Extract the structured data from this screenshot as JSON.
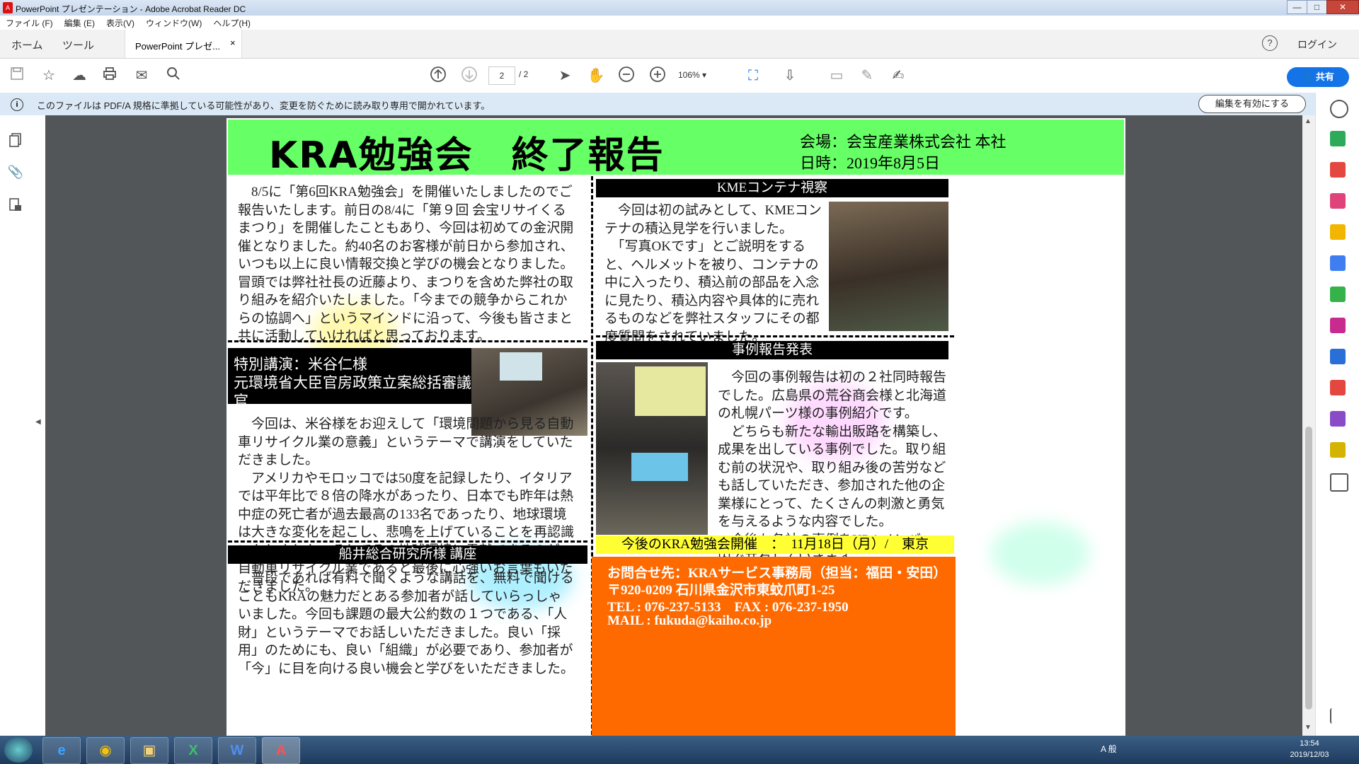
{
  "window": {
    "title": "PowerPoint プレゼンテーション - Adobe Acrobat Reader DC",
    "controls": [
      "—",
      "□",
      "✕"
    ]
  },
  "menu": [
    "ファイル (F)",
    "編集 (E)",
    "表示(V)",
    "ウィンドウ(W)",
    "ヘルプ(H)"
  ],
  "tabs": {
    "home": "ホーム",
    "tools": "ツール",
    "doc": "PowerPoint プレゼ...",
    "close": "×",
    "help": "?",
    "login": "ログイン"
  },
  "toolbar": {
    "page_current": "2",
    "page_total": "/ 2",
    "zoom": "106%",
    "share": "共有"
  },
  "infobar": {
    "icon": "i",
    "message": "このファイルは PDF/A 規格に準拠している可能性があり、変更を防ぐために読み取り専用で開かれています。",
    "button": "編集を有効にする"
  },
  "doc": {
    "header_title": "KRA勉強会　終了報告",
    "venue": "会場：会宝産業株式会社 本社",
    "date": "日時：2019年8月5日",
    "intro": "　8/5に「第6回KRA勉強会」を開催いたしましたのでご報告いたします。前日の8/4に「第９回 会宝リサイくるまつり」を開催したこともあり、今回は初めての金沢開催となりました。約40名のお客様が前日から参加され、いつも以上に良い情報交換と学びの機会となりました。冒頭では弊社社長の近藤より、まつりを含めた弊社の取り組みを紹介いたしました。「今までの競争からこれからの協調へ」というマインドに沿って、今後も皆さまと共に活動していければと思っております。",
    "special_title_1": "特別講演：米谷仁様",
    "special_title_2": "元環境省大臣官房政策立案総括審議官",
    "special_body": "　今回は、米谷様をお迎えして「環境問題から見る自動車リサイクル業の意義」というテーマで講演をしていただきました。\n　アメリカやモロッコでは50度を記録したり、イタリアでは平年比で８倍の降水があったり、日本でも昨年は熱中症の死亡者が過去最高の133名であったり、地球環境は大きな変化を起こし、悲鳴を上げていることを再認識いたしました。そしてその地球環境に貢献できるのが、自動車リサイクル業であると最後に心強いお言葉もいただきました。",
    "funai_title": "船井総合研究所様 講座",
    "funai_body": "　普段であれば有料で聞くような講話を、無料で聞けることもKRAの魅力だとある参加者が話していらっしゃいました。今回も課題の最大公約数の１つである、「人財」というテーマでお話しいただきました。良い「採用」のためにも、良い「組織」が必要であり、参加者が「今」に目を向ける良い機会と学びをいただきました。",
    "kme_title": "KMEコンテナ視察",
    "kme_body": "　今回は初の試みとして、KMEコンテナの積込見学を行いました。\n　「写真OKです」とご説明をすると、ヘルメットを被り、コンテナの中に入ったり、積込前の部品を入念に見たり、積込内容や具体的に売れるものなどを弊社スタッフにその都度質問をされていました。",
    "case_title": "事例報告発表",
    "case_body": "　今回の事例報告は初の２社同時報告でした。広島県の荒谷商会様と北海道の札幌パーツ様の事例紹介です。\n　どちらも新たな輸出販路を構築し、成果を出している事例でした。取り組む前の状況や、取り組み後の苦労なども話していただき、参加された他の企業様にとって、たくさんの刺激と勇気を与えるような内容でした。\n　今後も各社の事例をKRAメンバー内で共有していきます。",
    "next_event": "今後のKRA勉強会開催　：　11月18日（月）/　東京",
    "contact_1": "お問合せ先：KRAサービス事務局（担当：福田・安田）",
    "contact_2": "〒920-0209 石川県金沢市東蚊爪町1-25",
    "contact_3": "TEL : 076-237-5133　FAX : 076-237-1950",
    "contact_4": "MAIL : fukuda@kaiho.co.jp"
  },
  "taskbar": {
    "tray": "A 般",
    "time": "13:54",
    "date": "2019/12/03"
  },
  "colors": {
    "header_green": "#66ff66",
    "accent_orange": "#ff6a00",
    "banner_yellow": "#ffff33",
    "share_blue": "#1473e6"
  }
}
